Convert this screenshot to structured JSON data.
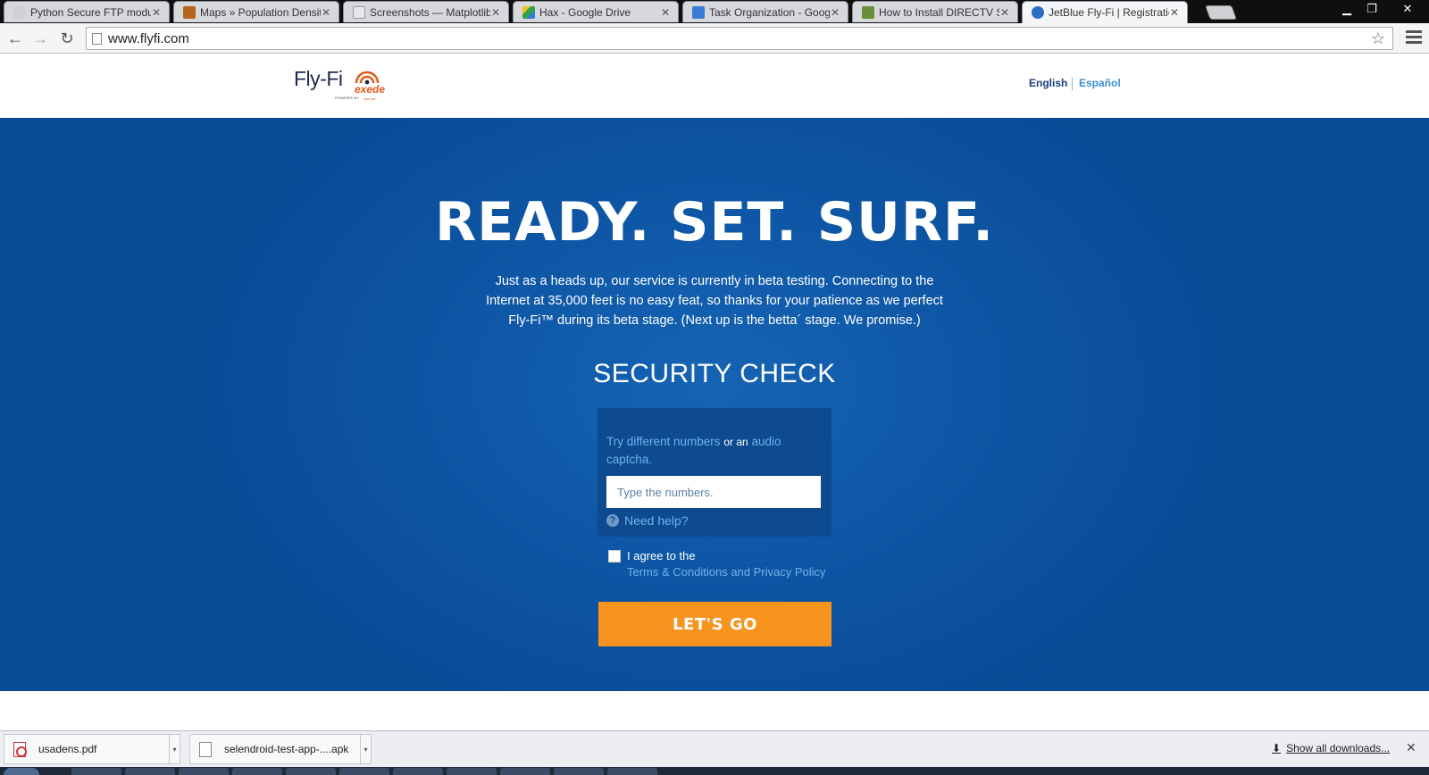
{
  "browser": {
    "tabs": [
      {
        "title": "Python Secure FTP modul",
        "favicon_color": "#cfd1d5",
        "active": false
      },
      {
        "title": "Maps » Population Densit",
        "favicon_color": "#b5651d",
        "active": false
      },
      {
        "title": "Screenshots — Matplotlib",
        "favicon_color": "#cfd1d5",
        "active": false
      },
      {
        "title": "Hax - Google Drive",
        "favicon_color": "#2fa24c",
        "active": false
      },
      {
        "title": "Task Organization - Googl",
        "favicon_color": "#3b79d8",
        "active": false
      },
      {
        "title": "How to Install DIRECTV Sa",
        "favicon_color": "#6a8f3b",
        "active": false
      },
      {
        "title": "JetBlue Fly-Fi | Registration",
        "favicon_color": "#2a6fc2",
        "active": true
      }
    ],
    "window_controls": {
      "minimize": "▁",
      "restore": "❐",
      "close": "✕"
    },
    "nav": {
      "back": "←",
      "forward": "→",
      "reload": "↻"
    },
    "url": "www.flyfi.com",
    "star": "☆"
  },
  "header": {
    "logo_text": "Fly-Fi",
    "logo_powered": "POWERED BY",
    "logo_brand": "exede",
    "logo_brand_sub": "internet",
    "lang_english": "English",
    "lang_espanol": "Español"
  },
  "hero": {
    "headline": "READY. SET. SURF.",
    "intro": "Just as a heads up, our service is currently in beta testing. Connecting to the Internet at 35,000 feet is no easy feat, so thanks for your patience as we perfect Fly-Fi™ during its beta stage. (Next up is the betta´ stage. We promise.)",
    "security_title": "SECURITY CHECK",
    "captcha": {
      "link_numbers": "Try different numbers",
      "or_an": "or an",
      "link_audio": "audio captcha.",
      "input_placeholder": "Type the numbers.",
      "input_value": "",
      "help_icon": "?",
      "help_label": "Need help?"
    },
    "agree_label": "I agree to the",
    "terms_label": "Terms & Conditions and Privacy Policy",
    "agree_checked": false,
    "submit_label": "LET'S GO"
  },
  "downloads": {
    "items": [
      {
        "name": "usadens.pdf",
        "type": "pdf"
      },
      {
        "name": "selendroid-test-app-....apk",
        "type": "file"
      }
    ],
    "dropdown_glyph": "▾",
    "show_all_icon": "⬇",
    "show_all_label": "Show all downloads...",
    "close": "✕"
  }
}
